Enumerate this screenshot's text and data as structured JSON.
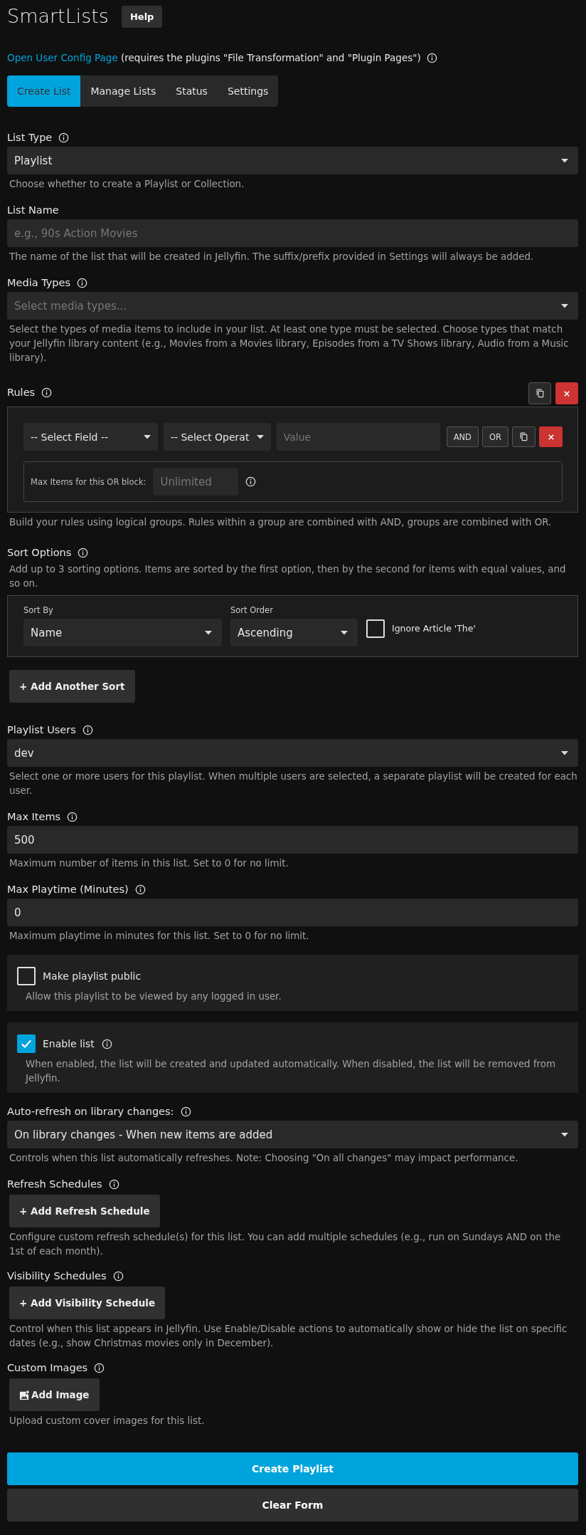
{
  "header": {
    "title": "SmartLists",
    "help_button": "Help"
  },
  "config_link": {
    "link": "Open User Config Page",
    "note": "(requires the plugins \"File Transformation\" and \"Plugin Pages\")",
    "info": true
  },
  "tabs": [
    {
      "label": "Create List",
      "selected": true
    },
    {
      "label": "Manage Lists",
      "selected": false
    },
    {
      "label": "Status",
      "selected": false
    },
    {
      "label": "Settings",
      "selected": false
    }
  ],
  "form": [
    {
      "kind": "select",
      "label": "List Type",
      "info": true,
      "value": "Playlist",
      "help": "Choose whether to create a Playlist or Collection."
    },
    {
      "kind": "input",
      "label": "List Name",
      "placeholder": "e.g., 90s Action Movies",
      "help": "The name of the list that will be created in Jellyfin. The suffix/prefix provided in Settings will always be added."
    },
    {
      "kind": "select",
      "label": "Media Types",
      "info": true,
      "placeholder": "Select media types...",
      "help": "Select the types of media items to include in your list. At least one type must be selected. Choose types that match your Jellyfin library content (e.g., Movies from a Movies library, Episodes from a TV Shows library, Audio from a Music library)."
    },
    {
      "kind": "rules",
      "label": "Rules",
      "info": true,
      "field": "-- Select Field --",
      "operator": "-- Select Operat",
      "value_placeholder": "Value",
      "logic_buttons": [
        "AND",
        "OR"
      ],
      "max_items_label": "Max Items for this OR block:",
      "max_items_placeholder": "Unlimited",
      "max_items_info": true,
      "help": "Build your rules using logical groups. Rules within a group are combined with AND, groups are combined with OR."
    },
    {
      "kind": "sort",
      "label": "Sort Options",
      "info": true,
      "help": "Add up to 3 sorting options. Items are sorted by the first option, then by the second for items with equal values, and so on.",
      "sort_by": {
        "label": "Sort By",
        "value": "Name"
      },
      "sort_order": {
        "label": "Sort Order",
        "value": "Ascending"
      },
      "ignore_article": {
        "label": "Ignore Article 'The'",
        "checked": false
      }
    },
    {
      "kind": "button",
      "label": "+ Add Another Sort"
    },
    {
      "kind": "select",
      "label": "Playlist Users",
      "info": true,
      "value": "dev",
      "help": "Select one or more users for this playlist. When multiple users are selected, a separate playlist will be created for each user."
    },
    {
      "kind": "input",
      "label": "Max Items",
      "info": true,
      "value": "500",
      "help": "Maximum number of items in this list. Set to 0 for no limit."
    },
    {
      "kind": "input",
      "label": "Max Playtime (Minutes)",
      "info": true,
      "value": "0",
      "help": "Maximum playtime in minutes for this list. Set to 0 for no limit."
    },
    {
      "kind": "checkbox_card",
      "label": "Make playlist public",
      "checked": false,
      "help": "Allow this playlist to be viewed by any logged in user."
    },
    {
      "kind": "checkbox_card",
      "label": "Enable list",
      "info": true,
      "checked": true,
      "help": "When enabled, the list will be created and updated automatically. When disabled, the list will be removed from Jellyfin."
    },
    {
      "kind": "select",
      "label": "Auto-refresh on library changes:",
      "info": true,
      "value": "On library changes - When new items are added",
      "help": "Controls when this list automatically refreshes. Note: Choosing \"On all changes\" may impact performance."
    },
    {
      "kind": "button_field",
      "label": "Refresh Schedules",
      "info": true,
      "button": "+ Add Refresh Schedule",
      "help": "Configure custom refresh schedule(s) for this list. You can add multiple schedules (e.g., run on Sundays AND on the 1st of each month)."
    },
    {
      "kind": "button_field",
      "label": "Visibility Schedules",
      "info": true,
      "button": "+ Add Visibility Schedule",
      "help": "Control when this list appears in Jellyfin. Use Enable/Disable actions to automatically show or hide the list on specific dates (e.g., show Christmas movies only in December)."
    },
    {
      "kind": "image_button_field",
      "label": "Custom Images",
      "info": true,
      "button": "Add Image",
      "help": "Upload custom cover images for this list."
    }
  ],
  "actions": [
    {
      "label": "Create Playlist",
      "kind": "primary"
    },
    {
      "label": "Clear Form",
      "kind": "secondary"
    }
  ]
}
